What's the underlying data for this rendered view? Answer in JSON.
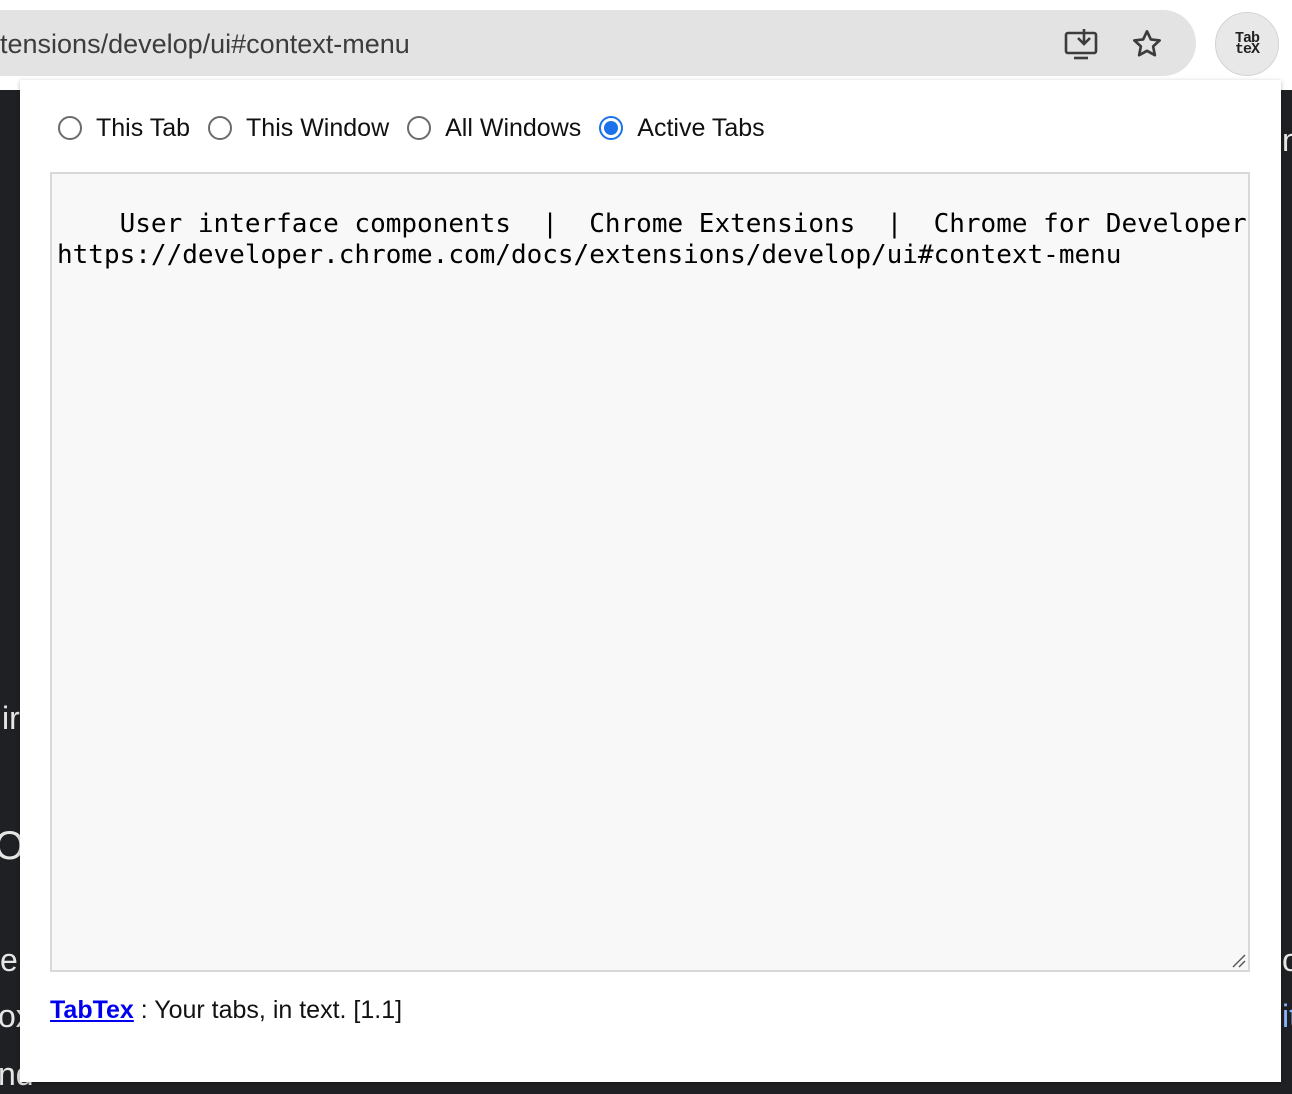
{
  "browser": {
    "url_visible": "tensions/develop/ui#context-menu",
    "icons": [
      "install-app-icon",
      "star-icon"
    ],
    "extension_logo": "TabTex"
  },
  "background_fragments": [
    "ir",
    "O",
    "e",
    "ox",
    "nd",
    "n",
    "or",
    "it"
  ],
  "popup": {
    "scopes": [
      {
        "label": "This Tab",
        "checked": false
      },
      {
        "label": "This Window",
        "checked": false
      },
      {
        "label": "All Windows",
        "checked": false
      },
      {
        "label": "Active Tabs",
        "checked": true
      }
    ],
    "output_text": "User interface components  |  Chrome Extensions  |  Chrome for Developers\nhttps://developer.chrome.com/docs/extensions/develop/ui#context-menu",
    "footer": {
      "link": "TabTex",
      "text": " : Your tabs, in text. [1.1]"
    }
  },
  "colors": {
    "accent": "#1a73e8",
    "link": "#0000ee",
    "page_dark": "#1f2023"
  }
}
